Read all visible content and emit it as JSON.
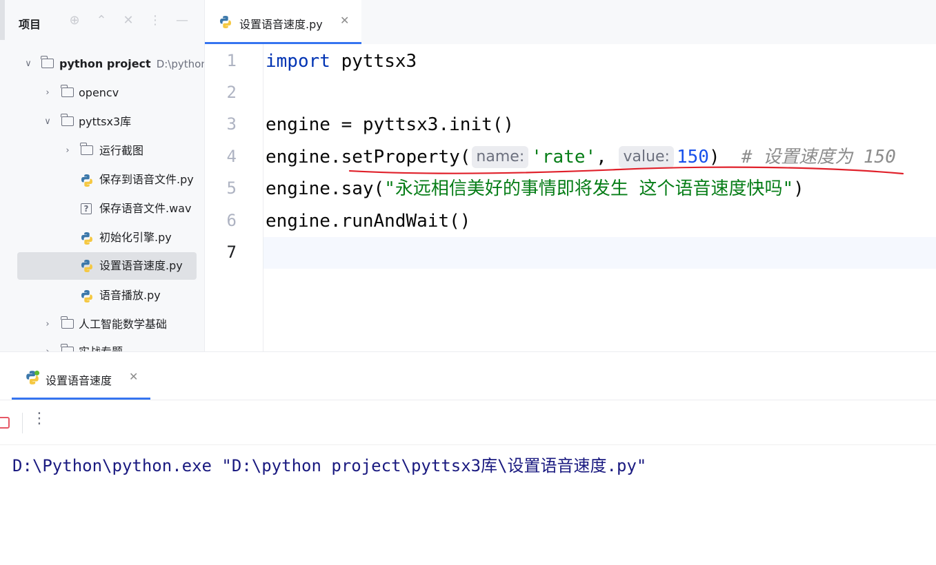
{
  "sidebar": {
    "title": "项目",
    "tree": [
      {
        "label": "python project",
        "hint": "D:\\python",
        "type": "folder",
        "expanded": true,
        "level": 0
      },
      {
        "label": "opencv",
        "type": "folder",
        "expanded": false,
        "level": 1
      },
      {
        "label": "pyttsx3库",
        "type": "folder",
        "expanded": true,
        "level": 1
      },
      {
        "label": "运行截图",
        "type": "folder",
        "expanded": false,
        "level": 2
      },
      {
        "label": "保存到语音文件.py",
        "type": "python-file",
        "level": 2
      },
      {
        "label": "保存语音文件.wav",
        "type": "unknown-file",
        "level": 2
      },
      {
        "label": "初始化引擎.py",
        "type": "python-file",
        "level": 2
      },
      {
        "label": "设置语音速度.py",
        "type": "python-file",
        "level": 2,
        "selected": true
      },
      {
        "label": "语音播放.py",
        "type": "python-file",
        "level": 2
      },
      {
        "label": "人工智能数学基础",
        "type": "folder",
        "expanded": false,
        "level": 1
      },
      {
        "label": "实战专题",
        "type": "folder",
        "expanded": false,
        "level": 1
      }
    ]
  },
  "editor": {
    "tab_label": "设置语音速度.py",
    "line_numbers": [
      "1",
      "2",
      "3",
      "4",
      "5",
      "6",
      "7"
    ],
    "active_line": "7",
    "code": {
      "l1_kw": "import",
      "l1_rest": " pyttsx3",
      "l3": "engine = pyttsx3.init()",
      "l4_a": "engine.setProperty(",
      "l4_hint_name": "name:",
      "l4_str": "'rate'",
      "l4_comma": ", ",
      "l4_hint_value": "value:",
      "l4_num": "150",
      "l4_close": ")  ",
      "l4_comment": "# 设置速度为 150",
      "l5_a": "engine.say(",
      "l5_str": "\"永远相信美好的事情即将发生 这个语音速度快吗\"",
      "l5_close": ")",
      "l6": "engine.runAndWait()"
    }
  },
  "run_panel": {
    "tab_label": "设置语音速度",
    "console_output": "D:\\Python\\python.exe \"D:\\python project\\pyttsx3库\\设置语音速度.py\""
  },
  "colors": {
    "accent": "#3574f0",
    "keyword": "#0033b3",
    "string": "#067d17",
    "number": "#1750eb",
    "comment": "#8c8c8c",
    "annotation_underline": "#e0202a"
  },
  "icons": [
    "locate-icon",
    "expand-all-icon",
    "collapse-all-icon",
    "more-vertical-icon",
    "hide-icon",
    "python-file-icon",
    "folder-icon",
    "chevron-icon",
    "close-icon",
    "stop-icon"
  ]
}
